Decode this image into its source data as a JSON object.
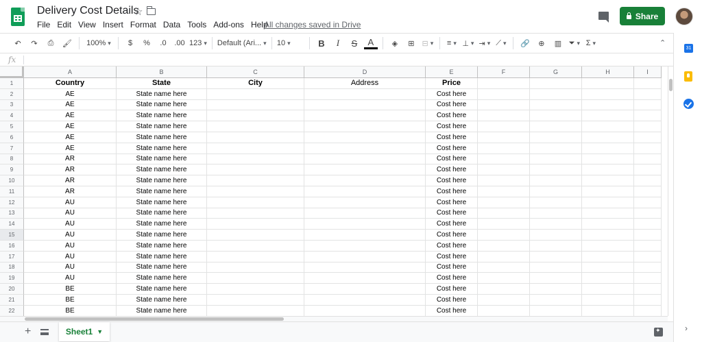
{
  "header": {
    "title": "Delivery Cost Details",
    "menu": [
      "File",
      "Edit",
      "View",
      "Insert",
      "Format",
      "Data",
      "Tools",
      "Add-ons",
      "Help"
    ],
    "saved_status": "All changes saved in Drive",
    "share_label": "Share"
  },
  "toolbar": {
    "zoom": "100%",
    "currency": "$",
    "percent": "%",
    "decrease_decimal": ".0",
    "increase_decimal": ".00",
    "more_formats": "123",
    "font": "Default (Ari...",
    "font_size": "10",
    "bold": "B",
    "italic": "I",
    "strike": "S",
    "text_color": "A",
    "sum": "Σ"
  },
  "formula_bar": {
    "fx": "fx"
  },
  "grid": {
    "columns": [
      "A",
      "B",
      "C",
      "D",
      "E",
      "F",
      "G",
      "H",
      "I"
    ],
    "rows": [
      [
        "Country",
        "State",
        "City",
        "Address",
        "Price"
      ],
      [
        "AE",
        "State name here",
        "",
        "",
        "Cost here"
      ],
      [
        "AE",
        "State name here",
        "",
        "",
        "Cost here"
      ],
      [
        "AE",
        "State name here",
        "",
        "",
        "Cost here"
      ],
      [
        "AE",
        "State name here",
        "",
        "",
        "Cost here"
      ],
      [
        "AE",
        "State name here",
        "",
        "",
        "Cost here"
      ],
      [
        "AE",
        "State name here",
        "",
        "",
        "Cost here"
      ],
      [
        "AR",
        "State name here",
        "",
        "",
        "Cost here"
      ],
      [
        "AR",
        "State name here",
        "",
        "",
        "Cost here"
      ],
      [
        "AR",
        "State name here",
        "",
        "",
        "Cost here"
      ],
      [
        "AR",
        "State name here",
        "",
        "",
        "Cost here"
      ],
      [
        "AU",
        "State name here",
        "",
        "",
        "Cost here"
      ],
      [
        "AU",
        "State name here",
        "",
        "",
        "Cost here"
      ],
      [
        "AU",
        "State name here",
        "",
        "",
        "Cost here"
      ],
      [
        "AU",
        "State name here",
        "",
        "",
        "Cost here"
      ],
      [
        "AU",
        "State name here",
        "",
        "",
        "Cost here"
      ],
      [
        "AU",
        "State name here",
        "",
        "",
        "Cost here"
      ],
      [
        "AU",
        "State name here",
        "",
        "",
        "Cost here"
      ],
      [
        "AU",
        "State name here",
        "",
        "",
        "Cost here"
      ],
      [
        "BE",
        "State name here",
        "",
        "",
        "Cost here"
      ],
      [
        "BE",
        "State name here",
        "",
        "",
        "Cost here"
      ],
      [
        "BE",
        "State name here",
        "",
        "",
        "Cost here"
      ]
    ],
    "selected_row": 15
  },
  "side_panel": {
    "calendar_day": "31"
  },
  "sheets": {
    "tabs": [
      "Sheet1"
    ],
    "active": "Sheet1"
  },
  "colors": {
    "brand": "#0f9d58",
    "share": "#188038",
    "accent": "#1a73e8"
  }
}
